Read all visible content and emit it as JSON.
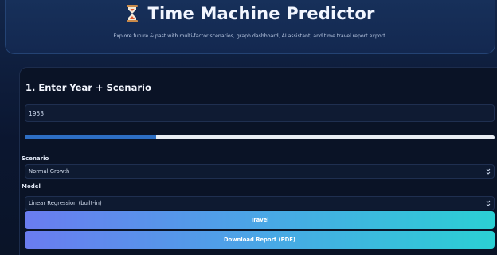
{
  "header": {
    "title": "Time Machine Predictor",
    "subtitle": "Explore future & past with multi-factor scenarios, graph dashboard, AI assistant, and time travel report export.",
    "icon": "hourglass-icon"
  },
  "input_section": {
    "title": "1. Enter Year + Scenario",
    "year_value": "1953",
    "slider_level": 0.28
  },
  "scenario": {
    "label": "Scenario",
    "selected": "Normal Growth"
  },
  "model": {
    "label": "Model",
    "selected": "Linear Regression (built-in)"
  },
  "buttons": {
    "travel": "Travel",
    "download": "Download Report (PDF)"
  },
  "colors": {
    "background": "#0c1a30",
    "accent_start": "#6a7cf0",
    "accent_end": "#2bd0d4",
    "slider_fill": "#2d6ec4"
  }
}
